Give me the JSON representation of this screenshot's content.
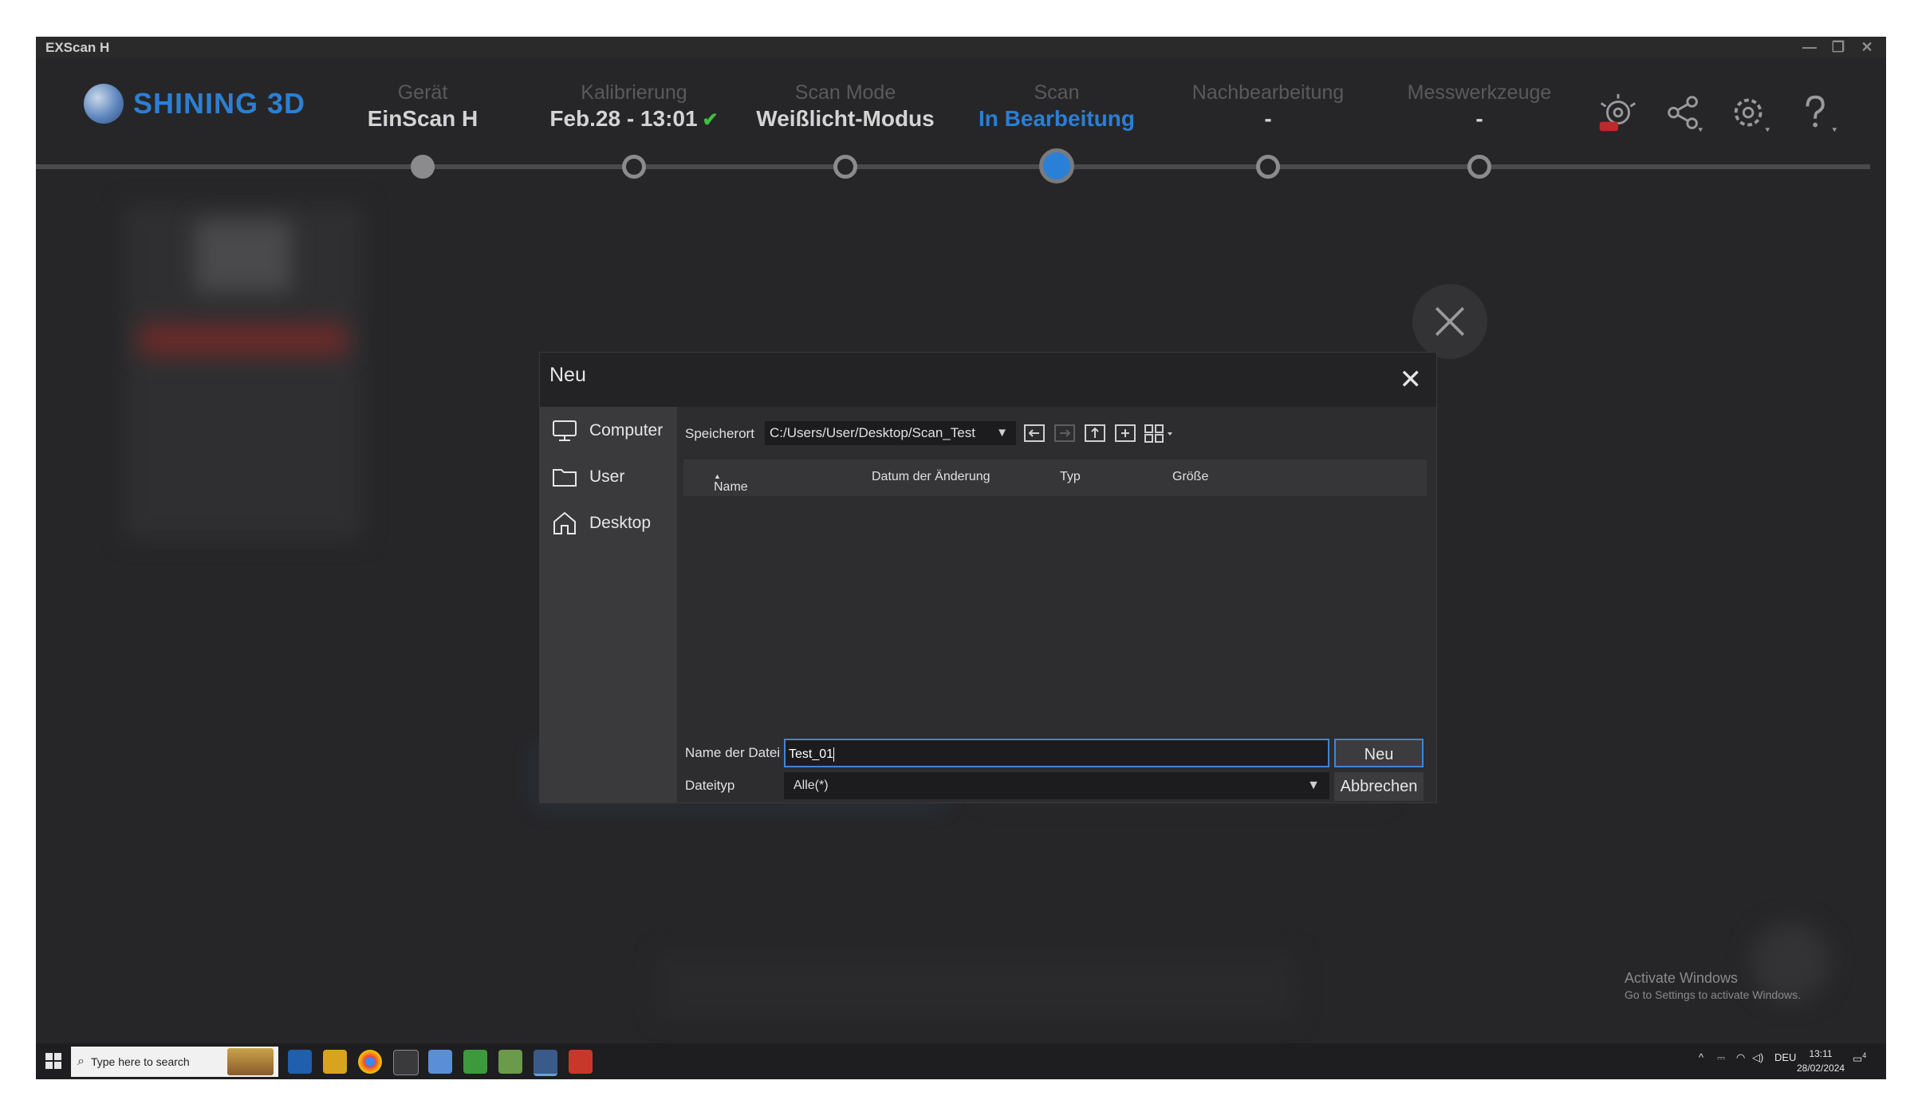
{
  "window": {
    "title": "EXScan H",
    "minimize_glyph": "—",
    "restore_glyph": "❐",
    "close_glyph": "✕"
  },
  "header": {
    "brand": "SHINING 3D",
    "steps": [
      {
        "label": "Gerät",
        "value": "EinScan H",
        "state": "done"
      },
      {
        "label": "Kalibrierung",
        "value": "Feb.28 - 13:01",
        "state": "done",
        "check": "✔"
      },
      {
        "label": "Scan Mode",
        "value": "Weißlicht-Modus",
        "state": "done"
      },
      {
        "label": "Scan",
        "value": "In Bearbeitung",
        "state": "active"
      },
      {
        "label": "Nachbearbeitung",
        "value": "-",
        "state": "pending"
      },
      {
        "label": "Messwerkzeuge",
        "value": "-",
        "state": "pending"
      }
    ],
    "icons": [
      "new-feature-icon",
      "share-icon",
      "gear-icon",
      "help-icon"
    ],
    "new_badge": "NEW"
  },
  "dialog": {
    "title": "Neu",
    "close_glyph": "✕",
    "sidebar": [
      {
        "label": "Computer",
        "icon": "monitor-icon"
      },
      {
        "label": "User",
        "icon": "folder-icon"
      },
      {
        "label": "Desktop",
        "icon": "home-icon"
      }
    ],
    "location_label": "Speicherort",
    "location_value": "C:/Users/User/Desktop/Scan_Test",
    "dropdown_glyph": "▼",
    "columns": {
      "name": "Name",
      "sort_glyph": "▲",
      "date": "Datum der Änderung",
      "type": "Typ",
      "size": "Größe"
    },
    "filename_label": "Name der Datei",
    "filename_value": "Test_01",
    "filetype_label": "Dateityp",
    "filetype_value": "Alle(*)",
    "confirm_label": "Neu",
    "cancel_label": "Abbrechen"
  },
  "watermark": {
    "line1": "Activate Windows",
    "line2": "Go to Settings to activate Windows."
  },
  "taskbar": {
    "search_placeholder": "Type here to search",
    "language": "DEU",
    "time": "13:11",
    "date": "28/02/2024",
    "notification_count": "4"
  },
  "colors": {
    "accent": "#2a80d6",
    "background": "#262628",
    "check": "#3fbf3f"
  }
}
